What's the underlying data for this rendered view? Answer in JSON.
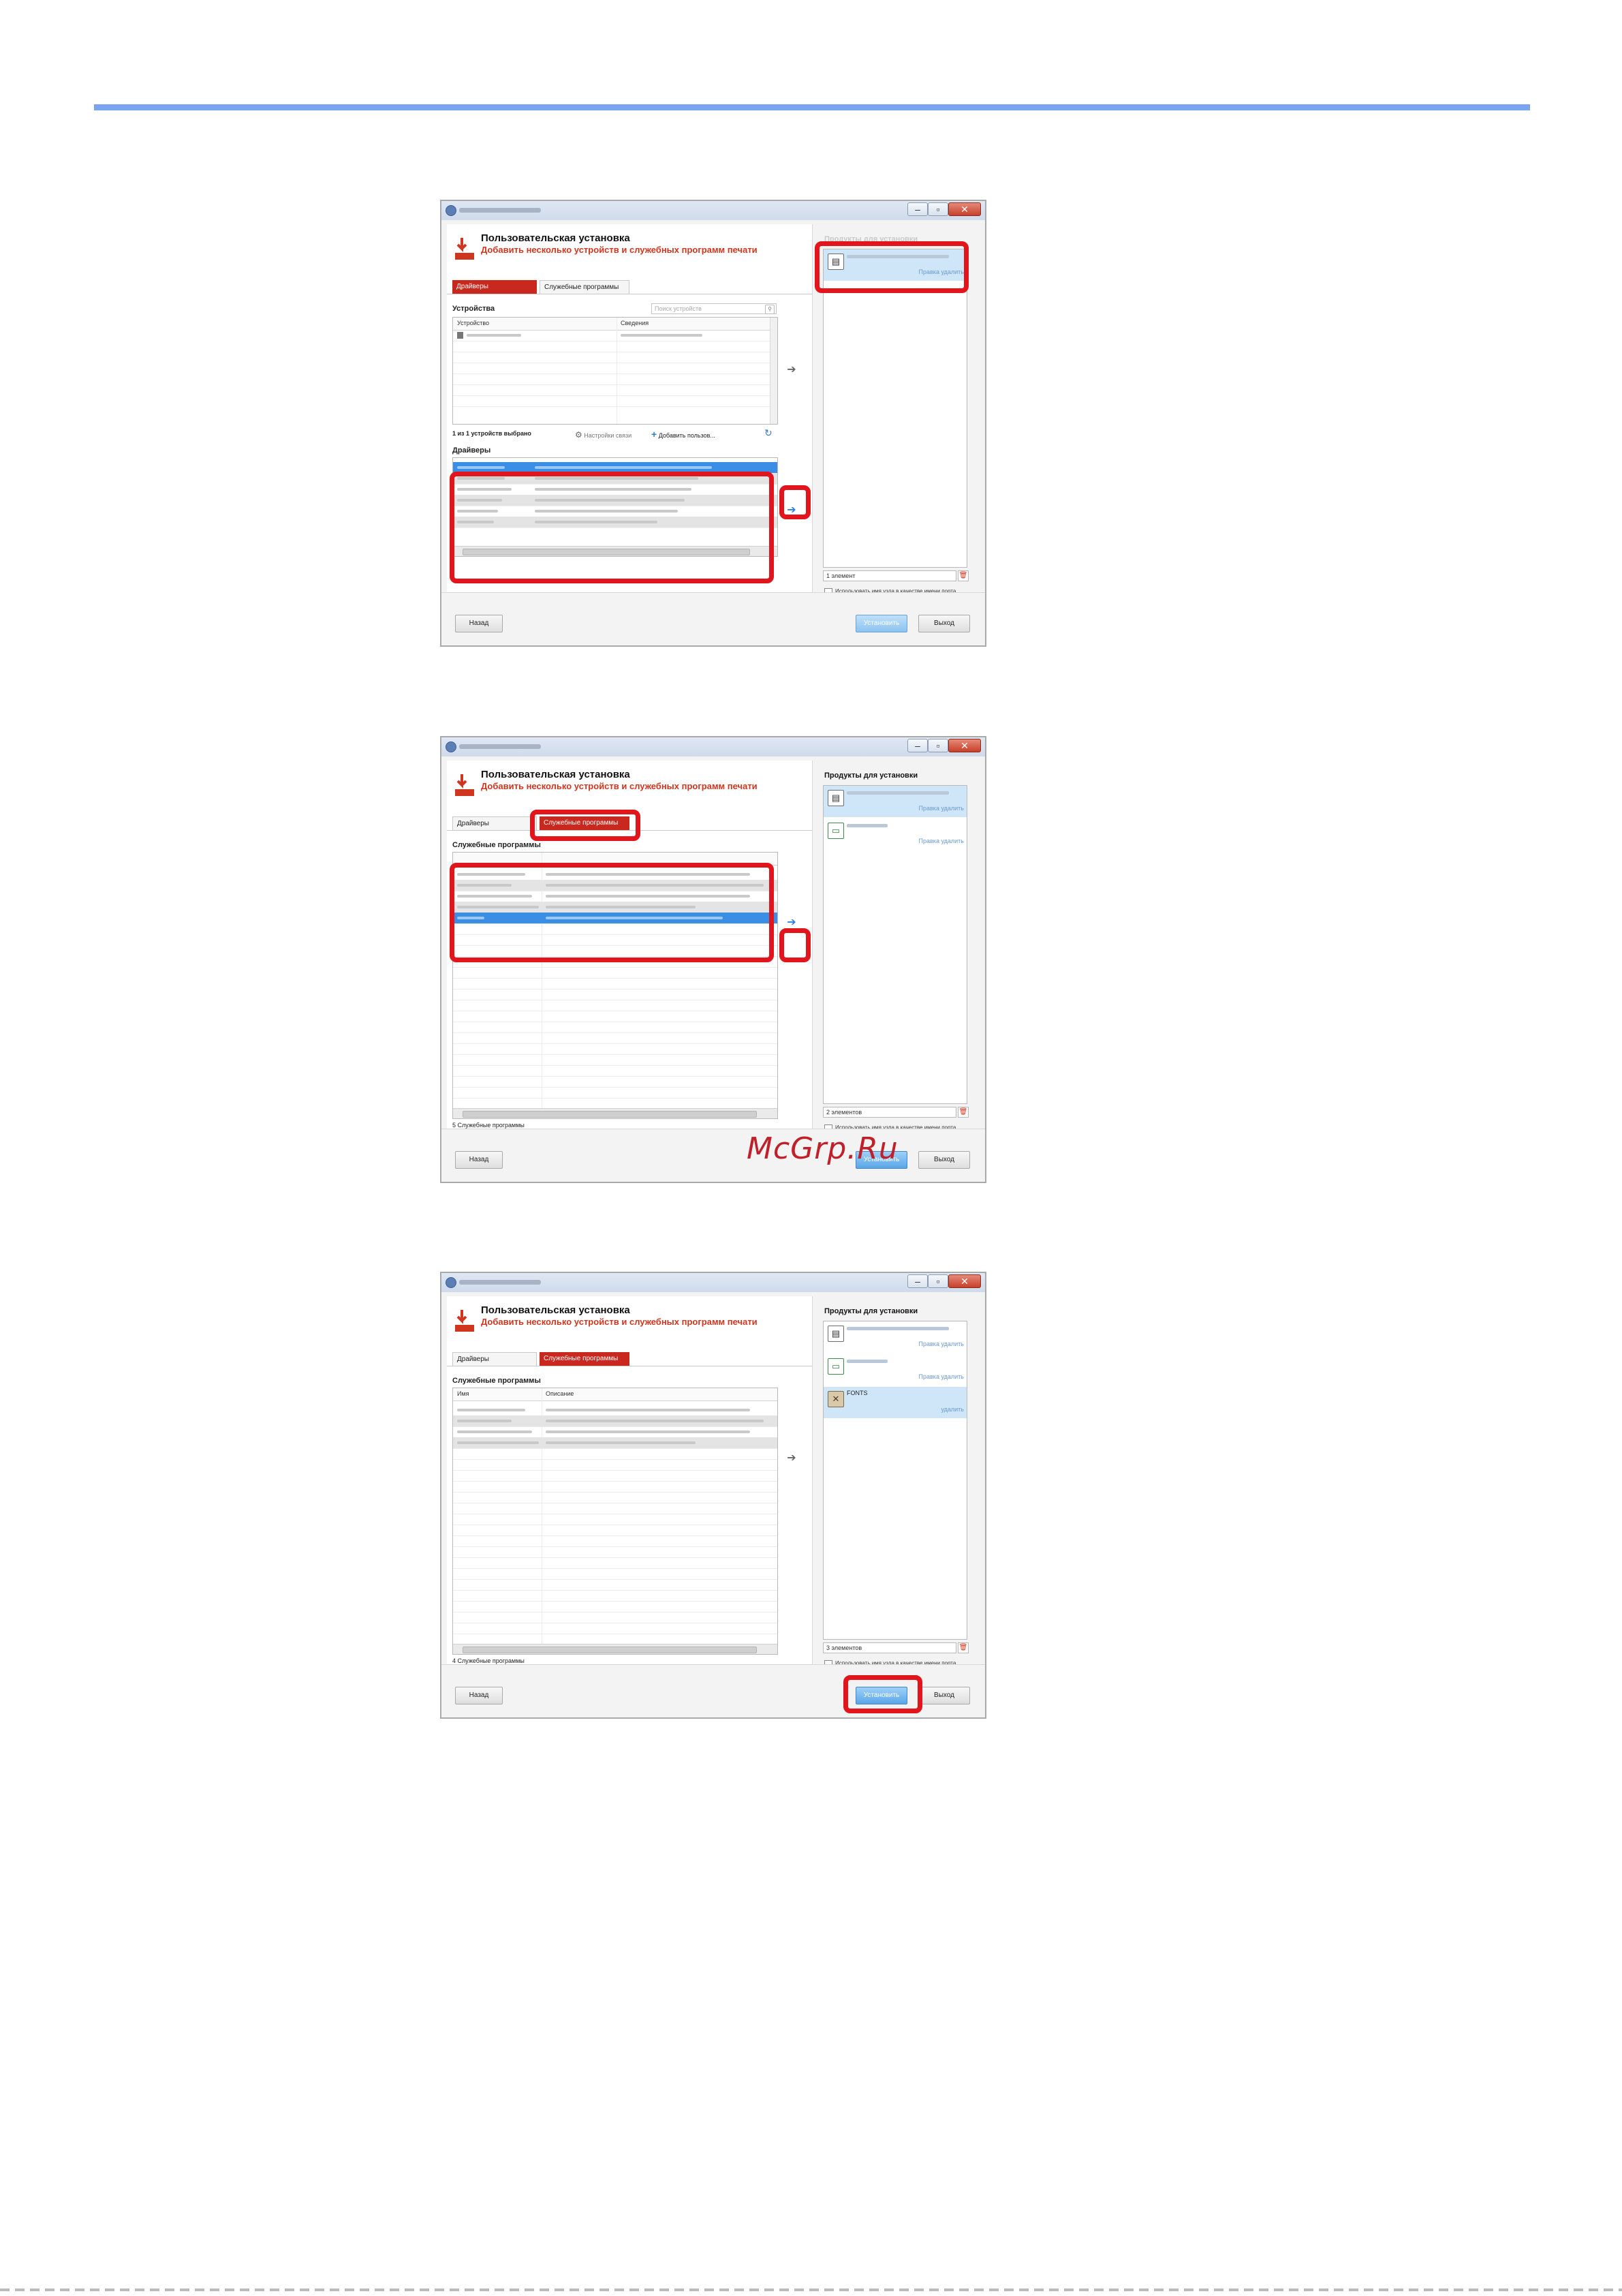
{
  "watermark": "McGrp.Ru",
  "dialog": {
    "title": "Пользовательская установка",
    "subtitle": "Добавить несколько устройств и служебных программ печати",
    "tabs": {
      "drivers": "Драйверы",
      "utilities": "Служебные программы"
    },
    "back_button": "Назад",
    "install_button": "Установить",
    "exit_button": "Выход",
    "use_hostname_checkbox": "Использовать имя узла в качестве имени порта",
    "products_heading": "Продукты для установки",
    "product_links": "Правка удалить",
    "product_links_remove_only": "удалить"
  },
  "step1": {
    "devices_label": "Устройства",
    "search_placeholder": "Поиск устройств",
    "device_columns": [
      "Устройство",
      "Сведения"
    ],
    "devices_selected": "1 из 1 устройств выбрано",
    "connection_settings": "Настройки связи",
    "add_custom": "Добавить пользов...",
    "drivers_label": "Драйверы",
    "products_count": "1 элемент"
  },
  "step2": {
    "utilities_label": "Служебные программы",
    "utilities_count": "5 Служебные программы",
    "products_count": "2 элементов"
  },
  "step3": {
    "utilities_label": "Служебные программы",
    "utility_columns": [
      "Имя",
      "Описание"
    ],
    "utilities_count": "4 Служебные программы",
    "font_product": "FONTS",
    "products_count": "3 элементов"
  },
  "colors": {
    "accent_red": "#c8281e",
    "callout_red": "#e2141c",
    "selection_blue": "#3a8ee6",
    "rule_blue": "#7aa3f0"
  }
}
